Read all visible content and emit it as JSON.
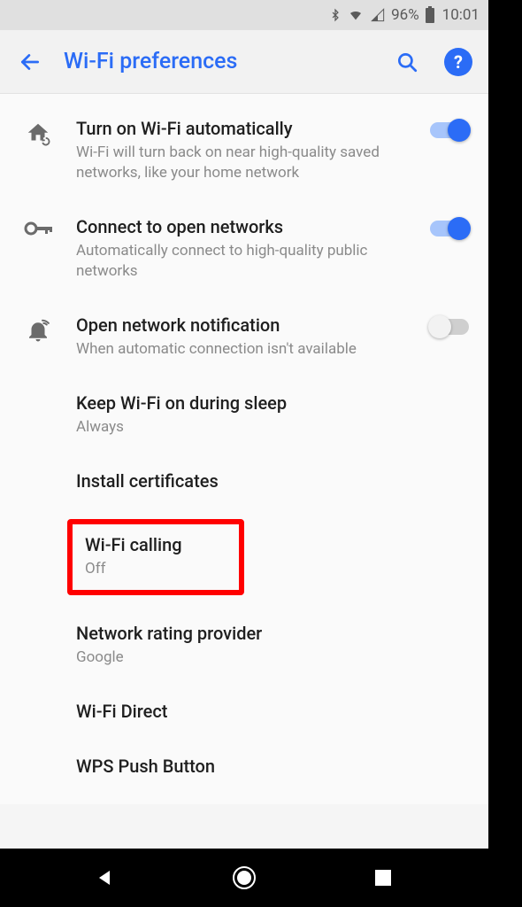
{
  "status": {
    "battery_pct": "96%",
    "time": "10:01"
  },
  "appbar": {
    "title": "Wi-Fi preferences"
  },
  "items": {
    "auto_wifi": {
      "title": "Turn on Wi-Fi automatically",
      "sub": "Wi-Fi will turn back on near high-quality saved networks, like your home network",
      "on": true
    },
    "open_net": {
      "title": "Connect to open networks",
      "sub": "Automatically connect to high-quality public networks",
      "on": true
    },
    "open_notif": {
      "title": "Open network notification",
      "sub": "When automatic connection isn't available",
      "on": false
    },
    "sleep": {
      "title": "Keep Wi-Fi on during sleep",
      "sub": "Always"
    },
    "certs": {
      "title": "Install certificates"
    },
    "wifi_calling": {
      "title": "Wi-Fi calling",
      "sub": "Off"
    },
    "rating": {
      "title": "Network rating provider",
      "sub": "Google"
    },
    "direct": {
      "title": "Wi-Fi Direct"
    },
    "wps": {
      "title": "WPS Push Button"
    }
  },
  "help_glyph": "?"
}
